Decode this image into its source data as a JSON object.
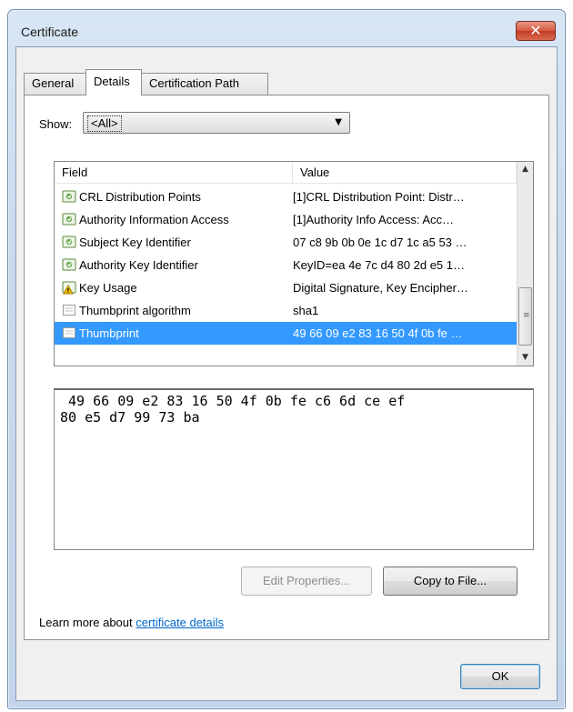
{
  "window": {
    "title": "Certificate",
    "close_glyph": "✕"
  },
  "tabs": [
    {
      "label": "General",
      "active": false
    },
    {
      "label": "Details",
      "active": true
    },
    {
      "label": "Certification Path",
      "active": false
    }
  ],
  "show": {
    "label": "Show:",
    "selected": "<All>"
  },
  "list": {
    "headers": {
      "field": "Field",
      "value": "Value"
    },
    "rows": [
      {
        "field": "CRL Distribution Points",
        "value": "[1]CRL Distribution Point: Distr…",
        "icon": "cert-extension-icon"
      },
      {
        "field": "Authority Information Access",
        "value": "[1]Authority Info Access: Acc…",
        "icon": "cert-extension-icon"
      },
      {
        "field": "Subject Key Identifier",
        "value": "07 c8 9b 0b 0e 1c d7 1c a5 53 …",
        "icon": "cert-extension-icon"
      },
      {
        "field": "Authority Key Identifier",
        "value": "KeyID=ea 4e 7c d4 80 2d e5 1…",
        "icon": "cert-extension-icon"
      },
      {
        "field": "Key Usage",
        "value": "Digital Signature, Key Encipher…",
        "icon": "critical-extension-icon"
      },
      {
        "field": "Thumbprint algorithm",
        "value": "sha1",
        "icon": "property-icon"
      },
      {
        "field": "Thumbprint",
        "value": "49 66 09 e2 83 16 50 4f 0b fe …",
        "icon": "property-icon",
        "selected": true
      }
    ]
  },
  "detail_text": " 49 66 09 e2 83 16 50 4f 0b fe c6 6d ce ef\n80 e5 d7 99 73 ba",
  "buttons": {
    "edit_properties": "Edit Properties...",
    "copy_to_file": "Copy to File...",
    "ok": "OK"
  },
  "learn_more": {
    "prefix": "Learn more about ",
    "link": "certificate details"
  },
  "colors": {
    "selection": "#3399ff",
    "link": "#0066cc",
    "close_button": "#c43c22"
  }
}
